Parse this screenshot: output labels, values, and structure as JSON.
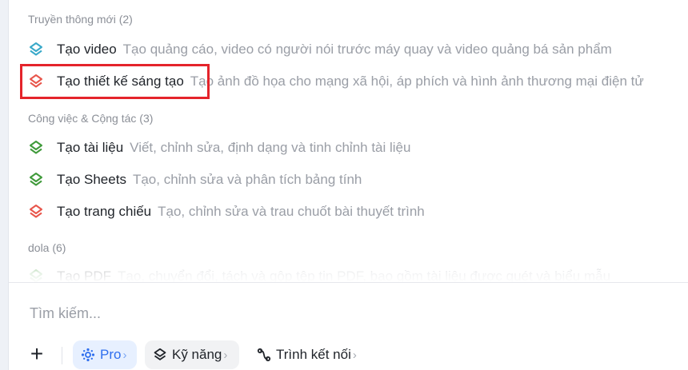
{
  "sections": [
    {
      "title": "Truyền thông mới (2)"
    },
    {
      "title": "Công việc & Cộng tác (3)"
    },
    {
      "title": "dola (6)"
    }
  ],
  "items": [
    {
      "label": "Tạo video",
      "desc": "Tạo quảng cáo, video có người nói trước máy quay và video quảng bá sản phẩm",
      "icon": "layers-icon",
      "color": "#39a9c9"
    },
    {
      "label": "Tạo thiết kế sáng tạo",
      "desc": "Tạo ảnh đồ họa cho mạng xã hội, áp phích và hình ảnh thương mại điện tử",
      "icon": "layers-icon",
      "color": "#e8554b"
    },
    {
      "label": "Tạo tài liệu",
      "desc": "Viết, chỉnh sửa, định dạng và tinh chỉnh tài liệu",
      "icon": "layers-icon",
      "color": "#3f9a3a"
    },
    {
      "label": "Tạo Sheets",
      "desc": "Tạo, chỉnh sửa và phân tích bảng tính",
      "icon": "layers-icon",
      "color": "#3f9a3a"
    },
    {
      "label": "Tạo trang chiếu",
      "desc": "Tạo, chỉnh sửa và trau chuốt bài thuyết trình",
      "icon": "layers-icon",
      "color": "#e8554b"
    },
    {
      "label": "Tạo PDF",
      "desc": "Tạo, chuyển đổi, tách và gộp tệp tin PDF, bao gồm tài liệu được quét và biểu mẫu",
      "icon": "layers-icon",
      "color": "#3f9a3a"
    }
  ],
  "search": {
    "placeholder": "Tìm kiếm..."
  },
  "toolbar": {
    "add_icon": "plus-icon",
    "pro_label": "Pro",
    "pro_chevron": "›",
    "skills_label": "Kỹ năng",
    "skills_chevron": "›",
    "connectors_label": "Trình kết nối",
    "connectors_chevron": "›"
  },
  "colors": {
    "accent": "#2f6fee",
    "highlight": "#e4242b"
  }
}
